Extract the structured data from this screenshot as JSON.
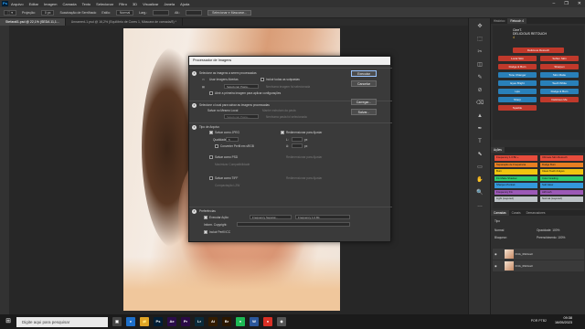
{
  "menubar": {
    "logo": "Ps",
    "items": [
      "Arquivo",
      "Editar",
      "Imagem",
      "Camada",
      "Texto",
      "Selecionar",
      "Filtro",
      "3D",
      "Visualizar",
      "Janela",
      "Ajuda"
    ],
    "controls": [
      "–",
      "❐",
      "✕"
    ]
  },
  "options": {
    "projection_label": "Projeção:",
    "projection_value": "0 px",
    "antialias": "Suavização de Serrilhado",
    "style_label": "Estilo:",
    "style_value": "Normal",
    "width_label": "Larg.:",
    "height_label": "Alt.:",
    "select_mask_btn": "Selecionar e Mascarar..."
  },
  "doc_tabs": [
    {
      "label": "Stefarall1.psd @ 22,1% (SEDA 11,1...",
      "active": true
    },
    {
      "label": "Unnamed-1.psd @ 16,2% (Equilíbrio de Cores 1, Máscara de camada/8) *",
      "active": false
    }
  ],
  "right_tools": [
    "✥",
    "⬚",
    "✂",
    "◫",
    "✎",
    "⊘",
    "⌫",
    "▲",
    "✒",
    "T",
    "⬉",
    "▭",
    "✋",
    "🔍",
    "…"
  ],
  "side_panel": {
    "tabs": [
      "Histórico",
      "Retouch 4"
    ],
    "logo_line1": "CineT.",
    "logo_line2": "DELICIOUS RETOUCH",
    "logo_tag": "4",
    "buttons": [
      {
        "label": "Delicious Retouch",
        "color": "#c0392b"
      },
      {
        "label": "Local Skin",
        "color": "#c0392b"
      },
      {
        "label": "Soften Skin",
        "color": "#c0392b"
      },
      {
        "label": "Dodge & Burn",
        "color": "#c0392b"
      },
      {
        "label": "Sharpen",
        "color": "#c0392b"
      },
      {
        "label": "Tone Changer",
        "color": "#2980b9"
      },
      {
        "label": "Skin Matte",
        "color": "#2980b9"
      },
      {
        "label": "Eyes Bright",
        "color": "#2980b9"
      },
      {
        "label": "Teeth White",
        "color": "#2980b9"
      },
      {
        "label": "Lips",
        "color": "#2980b9"
      },
      {
        "label": "Dodge & Burn",
        "color": "#2980b9"
      },
      {
        "label": "Sharp",
        "color": "#2980b9"
      },
      {
        "label": "Delicious Me",
        "color": "#c0392b"
      },
      {
        "label": "Sparkle",
        "color": "#c0392b"
      }
    ],
    "actions_title": "Ações",
    "actions": [
      {
        "label": "Frequency 1.0 Bit +",
        "color": "#e74c3c"
      },
      {
        "label": "Ultimate Skin Retouch",
        "color": "#e74c3c"
      },
      {
        "label": "Separação de Frequência",
        "color": "#e67e22"
      },
      {
        "label": "Dodge Burn",
        "color": "#e67e22"
      },
      {
        "label": "Burn",
        "color": "#f1c40f"
      },
      {
        "label": "Clean Teeth & Eyes",
        "color": "#f1c40f"
      },
      {
        "label": "Fix Matte Shadow",
        "color": "#2ecc71"
      },
      {
        "label": "Color Grading",
        "color": "#2ecc71"
      },
      {
        "label": "Sharpen Portrait",
        "color": "#3498db"
      },
      {
        "label": "Soft Glow",
        "color": "#3498db"
      },
      {
        "label": "Frequency Fix",
        "color": "#9b59b6"
      },
      {
        "label": "Airbrush",
        "color": "#9b59b6"
      },
      {
        "label": "Light (Layered)",
        "color": "#bdc3c7"
      },
      {
        "label": "Normal (Layered)",
        "color": "#bdc3c7"
      }
    ],
    "layers_tabs": [
      "Camadas",
      "Canais",
      "Demarcadores"
    ],
    "layers_kind": "Tipo",
    "blend_mode": "Normal",
    "opacity_label": "Opacidade: 100%",
    "fill_label": "Preenchimento: 100%",
    "lock_label": "Bloquear:",
    "layers": [
      {
        "name": "FOA_0921cell"
      },
      {
        "name": "FOA_0921cell"
      }
    ]
  },
  "dialog": {
    "title": "Processador de Imagens",
    "s1_heading": "Selecione as imagens a serem processadas",
    "s1_open": "Usar Imagens Abertas",
    "s1_sub": "Incluir todas as subpastas",
    "s1_select_folder": "Selecionar Pasta...",
    "s1_none": "Nenhuma imagem foi selecionada",
    "s1_first": "Abrir a primeira imagem para aplicar configurações",
    "s2_heading": "Selecione o local para salvar as imagens processadas",
    "s2_same": "Salvar no Mesmo Local",
    "s2_keep": "Manter estrutura da pasta",
    "s2_select_folder": "Selecionar Pasta...",
    "s2_none": "Nenhuma pasta foi selecionada",
    "s3_heading": "Tipo de Arquivo",
    "jpeg": "Salvar como JPEG",
    "resize1": "Redimensionar para Ajustar",
    "quality_label": "Qualidade:",
    "quality_value": "5",
    "w_label": "L:",
    "px": "px",
    "h_label": "A:",
    "srgb": "Converter Perfil em sRGB",
    "psd": "Salvar como PSD",
    "resize2": "Redimensionar para Ajustar",
    "maxcompat": "Maximizar Compatibilidade",
    "tiff": "Salvar como TIFF",
    "resize3": "Redimensionar para Ajustar",
    "lzw": "Compactação LZW",
    "s4_heading": "Preferências",
    "run_action": "Executar Ação:",
    "action_set": "Frequency Separat...",
    "action_name": "Frequency 1.0 Bit",
    "copyright_label": "Inform. Copyright:",
    "icc": "Incluir Perfil ICC",
    "btn_run": "Executar",
    "btn_cancel": "Cancelar",
    "btn_load": "Carregar...",
    "btn_save": "Salvar..."
  },
  "taskbar": {
    "search_placeholder": "Digite aqui para pesquisar",
    "apps": [
      {
        "label": "▣",
        "color": "#444"
      },
      {
        "label": "e",
        "color": "#1e6fc9"
      },
      {
        "label": "📁",
        "color": "#e0a526"
      },
      {
        "label": "Ps",
        "color": "#001e36"
      },
      {
        "label": "Ae",
        "color": "#2b0d4a"
      },
      {
        "label": "Pr",
        "color": "#2a0a46"
      },
      {
        "label": "Lr",
        "color": "#0a2a3a"
      },
      {
        "label": "Ai",
        "color": "#331c00"
      },
      {
        "label": "Br",
        "color": "#2b1700"
      },
      {
        "label": "●",
        "color": "#1db954"
      },
      {
        "label": "W",
        "color": "#2b579a"
      },
      {
        "label": "●",
        "color": "#d93025"
      },
      {
        "label": "◆",
        "color": "#555"
      }
    ],
    "time": "09:38",
    "date": "16/05/2023",
    "lang": "POR PTB2"
  }
}
